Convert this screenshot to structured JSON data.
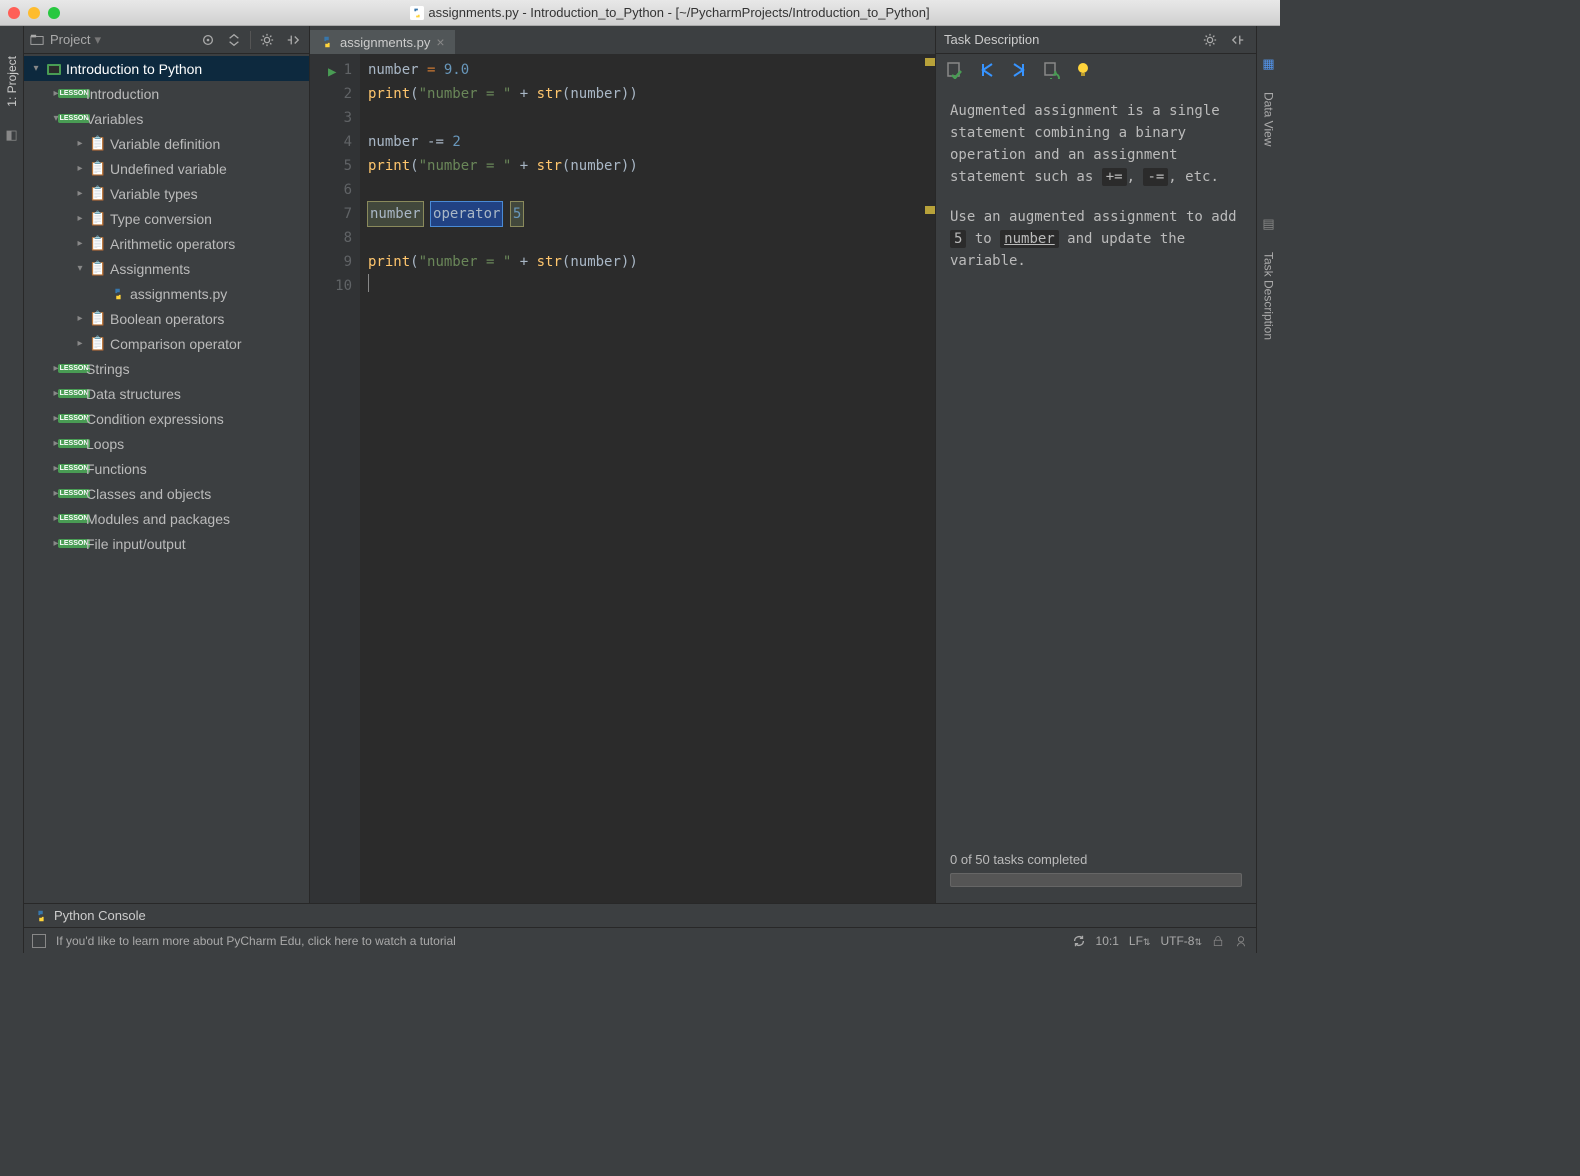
{
  "window": {
    "title": "assignments.py - Introduction_to_Python - [~/PycharmProjects/Introduction_to_Python]"
  },
  "leftRail": {
    "project": "1: Project"
  },
  "rightRail": {
    "dataView": "Data View",
    "taskDesc": "Task Description"
  },
  "panel": {
    "title": "Project"
  },
  "tree": {
    "root": "Introduction to Python",
    "items": [
      "Introduction",
      "Variables",
      "Variable definition",
      "Undefined variable",
      "Variable types",
      "Type conversion",
      "Arithmetic operators",
      "Assignments",
      "assignments.py",
      "Boolean operators",
      "Comparison operator",
      "Strings",
      "Data structures",
      "Condition expressions",
      "Loops",
      "Functions",
      "Classes and objects",
      "Modules and packages",
      "File input/output"
    ]
  },
  "tab": {
    "name": "assignments.py"
  },
  "gutter": [
    "1",
    "2",
    "3",
    "4",
    "5",
    "6",
    "7",
    "8",
    "9",
    "10"
  ],
  "code": {
    "l1a": "number ",
    "l1b": "= ",
    "l1c": "9.0",
    "l2a": "print",
    "l2b": "(",
    "l2c": "\"number = \"",
    "l2d": " + ",
    "l2e": "str",
    "l2f": "(number))",
    "l4a": "number ",
    "l4b": "-= ",
    "l4c": "2",
    "l5a": "print",
    "l5b": "(",
    "l5c": "\"number = \"",
    "l5d": " + ",
    "l5e": "str",
    "l5f": "(number))",
    "l7a": "number",
    "l7b": "operator",
    "l7c": "5",
    "l9a": "print",
    "l9b": "(",
    "l9c": "\"number = \"",
    "l9d": " + ",
    "l9e": "str",
    "l9f": "(number))"
  },
  "task": {
    "header": "Task Description",
    "p1a": "Augmented assignment is a single statement combining a binary operation and an assignment statement such as ",
    "p1b": "+=",
    "p1c": ", ",
    "p1d": "-=",
    "p1e": ", etc.",
    "p2a": "Use an augmented assignment to add ",
    "p2b": "5",
    "p2c": " to ",
    "p2d": "number",
    "p2e": " and update the variable.",
    "progress": "0 of 50 tasks completed"
  },
  "bottom": {
    "console": "Python Console",
    "hint": "If you'd like to learn more about PyCharm Edu, click here to watch a tutorial",
    "pos": "10:1",
    "lf": "LF",
    "enc": "UTF-8"
  }
}
